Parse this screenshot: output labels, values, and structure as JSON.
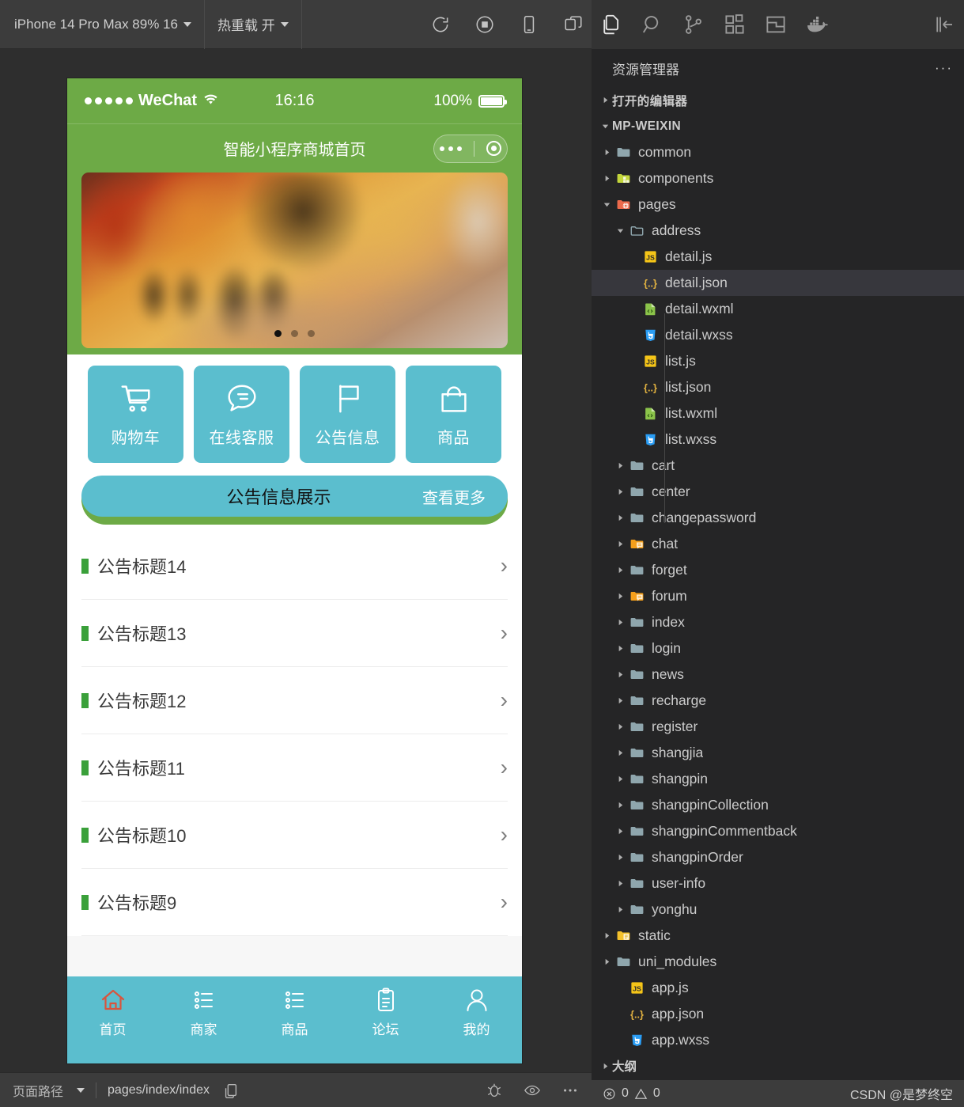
{
  "simulator": {
    "toolbar": {
      "device_label": "iPhone 14 Pro Max 89% 16",
      "hotreload_label": "热重载 开",
      "icons": [
        "refresh-icon",
        "stop-record-icon",
        "device-icon",
        "multi-window-icon"
      ]
    },
    "phone": {
      "status_bar": {
        "carrier": "WeChat",
        "time": "16:16",
        "battery_percent": "100%"
      },
      "nav_title": "智能小程序商城首页",
      "banner": {
        "dots": 3,
        "active_dot": 0
      },
      "grid": [
        {
          "label": "购物车",
          "icon": "cart-icon"
        },
        {
          "label": "在线客服",
          "icon": "chat-bubble-icon"
        },
        {
          "label": "公告信息",
          "icon": "flag-icon"
        },
        {
          "label": "商品",
          "icon": "bag-icon"
        }
      ],
      "notice_bar": {
        "title": "公告信息展示",
        "more": "查看更多"
      },
      "notices": [
        "公告标题14",
        "公告标题13",
        "公告标题12",
        "公告标题11",
        "公告标题10",
        "公告标题9"
      ],
      "tabbar": [
        {
          "label": "首页",
          "icon": "home-icon",
          "active": true
        },
        {
          "label": "商家",
          "icon": "list-icon",
          "active": false
        },
        {
          "label": "商品",
          "icon": "list-icon",
          "active": false
        },
        {
          "label": "论坛",
          "icon": "clipboard-icon",
          "active": false
        },
        {
          "label": "我的",
          "icon": "user-icon",
          "active": false
        }
      ]
    },
    "status_bar": {
      "label": "页面路径",
      "path": "pages/index/index",
      "copy_icon": "copy-icon",
      "icons": [
        "debug-bug-icon",
        "eye-icon",
        "more-icon"
      ]
    }
  },
  "sidebar": {
    "activity_icons": [
      "explorer-files-icon",
      "search-icon",
      "source-control-icon",
      "extensions-icon",
      "layout-icon",
      "docker-icon"
    ],
    "collapse_icon": "collapse-panel-icon",
    "title": "资源管理器",
    "more_label": "···",
    "sections": {
      "open_editors": "打开的编辑器",
      "project": "MP-WEIXIN",
      "outline": "大纲"
    },
    "tree": [
      {
        "label": "common",
        "type": "folder",
        "depth": 1,
        "expanded": false
      },
      {
        "label": "components",
        "type": "folder-comp",
        "depth": 1,
        "expanded": false
      },
      {
        "label": "pages",
        "type": "folder-pages",
        "depth": 1,
        "expanded": true
      },
      {
        "label": "address",
        "type": "folder-open",
        "depth": 2,
        "expanded": true
      },
      {
        "label": "detail.js",
        "type": "js",
        "depth": 3
      },
      {
        "label": "detail.json",
        "type": "json",
        "depth": 3,
        "selected": true
      },
      {
        "label": "detail.wxml",
        "type": "wxml",
        "depth": 3
      },
      {
        "label": "detail.wxss",
        "type": "wxss",
        "depth": 3
      },
      {
        "label": "list.js",
        "type": "js",
        "depth": 3
      },
      {
        "label": "list.json",
        "type": "json",
        "depth": 3
      },
      {
        "label": "list.wxml",
        "type": "wxml",
        "depth": 3
      },
      {
        "label": "list.wxss",
        "type": "wxss",
        "depth": 3
      },
      {
        "label": "cart",
        "type": "folder",
        "depth": 2,
        "expanded": false
      },
      {
        "label": "center",
        "type": "folder",
        "depth": 2,
        "expanded": false
      },
      {
        "label": "changepassword",
        "type": "folder",
        "depth": 2,
        "expanded": false
      },
      {
        "label": "chat",
        "type": "folder-chat",
        "depth": 2,
        "expanded": false
      },
      {
        "label": "forget",
        "type": "folder",
        "depth": 2,
        "expanded": false
      },
      {
        "label": "forum",
        "type": "folder-chat",
        "depth": 2,
        "expanded": false
      },
      {
        "label": "index",
        "type": "folder",
        "depth": 2,
        "expanded": false
      },
      {
        "label": "login",
        "type": "folder",
        "depth": 2,
        "expanded": false
      },
      {
        "label": "news",
        "type": "folder",
        "depth": 2,
        "expanded": false
      },
      {
        "label": "recharge",
        "type": "folder",
        "depth": 2,
        "expanded": false
      },
      {
        "label": "register",
        "type": "folder",
        "depth": 2,
        "expanded": false
      },
      {
        "label": "shangjia",
        "type": "folder",
        "depth": 2,
        "expanded": false
      },
      {
        "label": "shangpin",
        "type": "folder",
        "depth": 2,
        "expanded": false
      },
      {
        "label": "shangpinCollection",
        "type": "folder",
        "depth": 2,
        "expanded": false
      },
      {
        "label": "shangpinCommentback",
        "type": "folder",
        "depth": 2,
        "expanded": false
      },
      {
        "label": "shangpinOrder",
        "type": "folder",
        "depth": 2,
        "expanded": false
      },
      {
        "label": "user-info",
        "type": "folder",
        "depth": 2,
        "expanded": false
      },
      {
        "label": "yonghu",
        "type": "folder",
        "depth": 2,
        "expanded": false
      },
      {
        "label": "static",
        "type": "folder-static",
        "depth": 1,
        "expanded": false
      },
      {
        "label": "uni_modules",
        "type": "folder",
        "depth": 1,
        "expanded": false
      },
      {
        "label": "app.js",
        "type": "js",
        "depth": 2
      },
      {
        "label": "app.json",
        "type": "json",
        "depth": 2
      },
      {
        "label": "app.wxss",
        "type": "wxss",
        "depth": 2
      }
    ],
    "status": {
      "errors": "0",
      "warnings": "0",
      "watermark": "CSDN @是梦终空"
    }
  },
  "colors": {
    "green": "#6daa46",
    "teal": "#5bbece",
    "accent_red": "#d9543d",
    "editor_bg": "#252526",
    "selection": "#37373d"
  }
}
